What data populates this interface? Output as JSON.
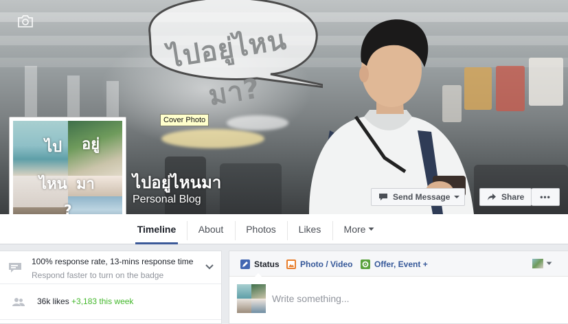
{
  "cover": {
    "bubble_text": "ไปอยู่ไหนมา?",
    "tooltip": "Cover Photo"
  },
  "page": {
    "name": "ไปอยู่ไหนมา",
    "category": "Personal Blog"
  },
  "profile_collage": {
    "word_1": "ไป",
    "word_2": "อยู่",
    "word_3": "ไหน",
    "word_4": "มา",
    "word_5": "?"
  },
  "actions": {
    "send_message": "Send Message",
    "share": "Share",
    "more": "•••"
  },
  "nav": {
    "tabs": [
      {
        "label": "Timeline"
      },
      {
        "label": "About"
      },
      {
        "label": "Photos"
      },
      {
        "label": "Likes"
      },
      {
        "label": "More"
      }
    ],
    "active": "Timeline"
  },
  "sidebar": {
    "response_rate": "100% response rate, 13-mins response time",
    "response_hint": "Respond faster to turn on the badge",
    "likes": "36k likes",
    "likes_growth": "+3,183 this week"
  },
  "composer": {
    "tabs": [
      {
        "label": "Status"
      },
      {
        "label": "Photo / Video"
      },
      {
        "label": "Offer, Event +"
      }
    ],
    "placeholder": "Write something..."
  },
  "colors": {
    "link_blue": "#365899",
    "accent_blue": "#3b5998",
    "growth_green": "#42b72a",
    "muted_text": "#90949c",
    "tooltip_bg": "#ffffcc"
  },
  "icons": {
    "cover_camera": "camera-icon",
    "profile_camera": "camera-icon",
    "send_message": "chat-bubble-icon",
    "share": "share-arrow-icon",
    "response": "message-icon",
    "likes": "people-icon",
    "status": "pencil-icon",
    "photo": "photo-icon",
    "offer": "offer-gear-icon"
  }
}
